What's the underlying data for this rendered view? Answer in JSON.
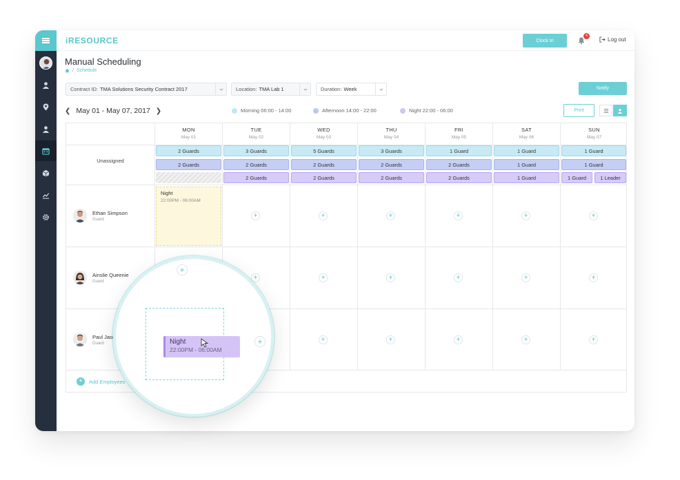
{
  "app": {
    "brand": "iRESOURCE"
  },
  "header": {
    "clock_in_label": "Clock In",
    "notification_count": "4",
    "logout_label": "Log out"
  },
  "page": {
    "title": "Manual Scheduling",
    "breadcrumb_current": "Schedule"
  },
  "filters": {
    "contract": {
      "label": "Contract ID:",
      "value": "TMA Solutions Security Contract 2017"
    },
    "location": {
      "label": "Location:",
      "value": "TMA Lab 1"
    },
    "duration": {
      "label": "Duration:",
      "value": "Week"
    },
    "notify_label": "Notify"
  },
  "week": {
    "range": "May 01 - May 07, 2017"
  },
  "legend": [
    {
      "label": "Morning 06:00 - 14:00",
      "color": "#bfe8f5"
    },
    {
      "label": "Afternoon 14:00 - 22:00",
      "color": "#bcc7f2"
    },
    {
      "label": "Night 22:00 - 06:00",
      "color": "#d3c4f6"
    }
  ],
  "print_label": "Print",
  "days": [
    {
      "name": "MON",
      "date": "May 01"
    },
    {
      "name": "TUE",
      "date": "May 02"
    },
    {
      "name": "WED",
      "date": "May 03"
    },
    {
      "name": "THU",
      "date": "May 04"
    },
    {
      "name": "FRI",
      "date": "May 05"
    },
    {
      "name": "SAT",
      "date": "May 06"
    },
    {
      "name": "SUN",
      "date": "May 07"
    }
  ],
  "unassigned": {
    "label": "Unassigned",
    "morning": [
      "2 Guards",
      "3 Guards",
      "5 Guards",
      "3 Guards",
      "1 Guard",
      "1 Guard",
      "1 Guard"
    ],
    "afternoon": [
      "2 Guards",
      "2 Guards",
      "2 Guards",
      "2 Guards",
      "2 Guards",
      "1 Guard",
      "1 Guard"
    ],
    "night": [
      "",
      "2 Guards",
      "2 Guards",
      "2 Guards",
      "2 Guards",
      "1 Guard",
      "1 Guard",
      "1 Leader"
    ]
  },
  "employees": [
    {
      "name": "Ethan Simpson",
      "role": "Guard"
    },
    {
      "name": "Ainslie Queenie",
      "role": "Guard"
    },
    {
      "name": "Paul Jaso",
      "role": "Guard"
    }
  ],
  "shift_card": {
    "title": "Night",
    "hours": "22:00PM - 06:00AM"
  },
  "add_employees_label": "Add Employees",
  "drag_card": {
    "title": "Night",
    "hours": "22:00PM - 06:00AM"
  },
  "icons": [
    "menu-icon",
    "user-icon",
    "location-pin-icon",
    "person-icon",
    "calendar-icon",
    "box-icon",
    "chart-icon",
    "gear-icon",
    "bell-icon",
    "logout-icon",
    "home-icon",
    "list-view-icon",
    "person-view-icon",
    "plus-icon",
    "cursor-icon"
  ]
}
